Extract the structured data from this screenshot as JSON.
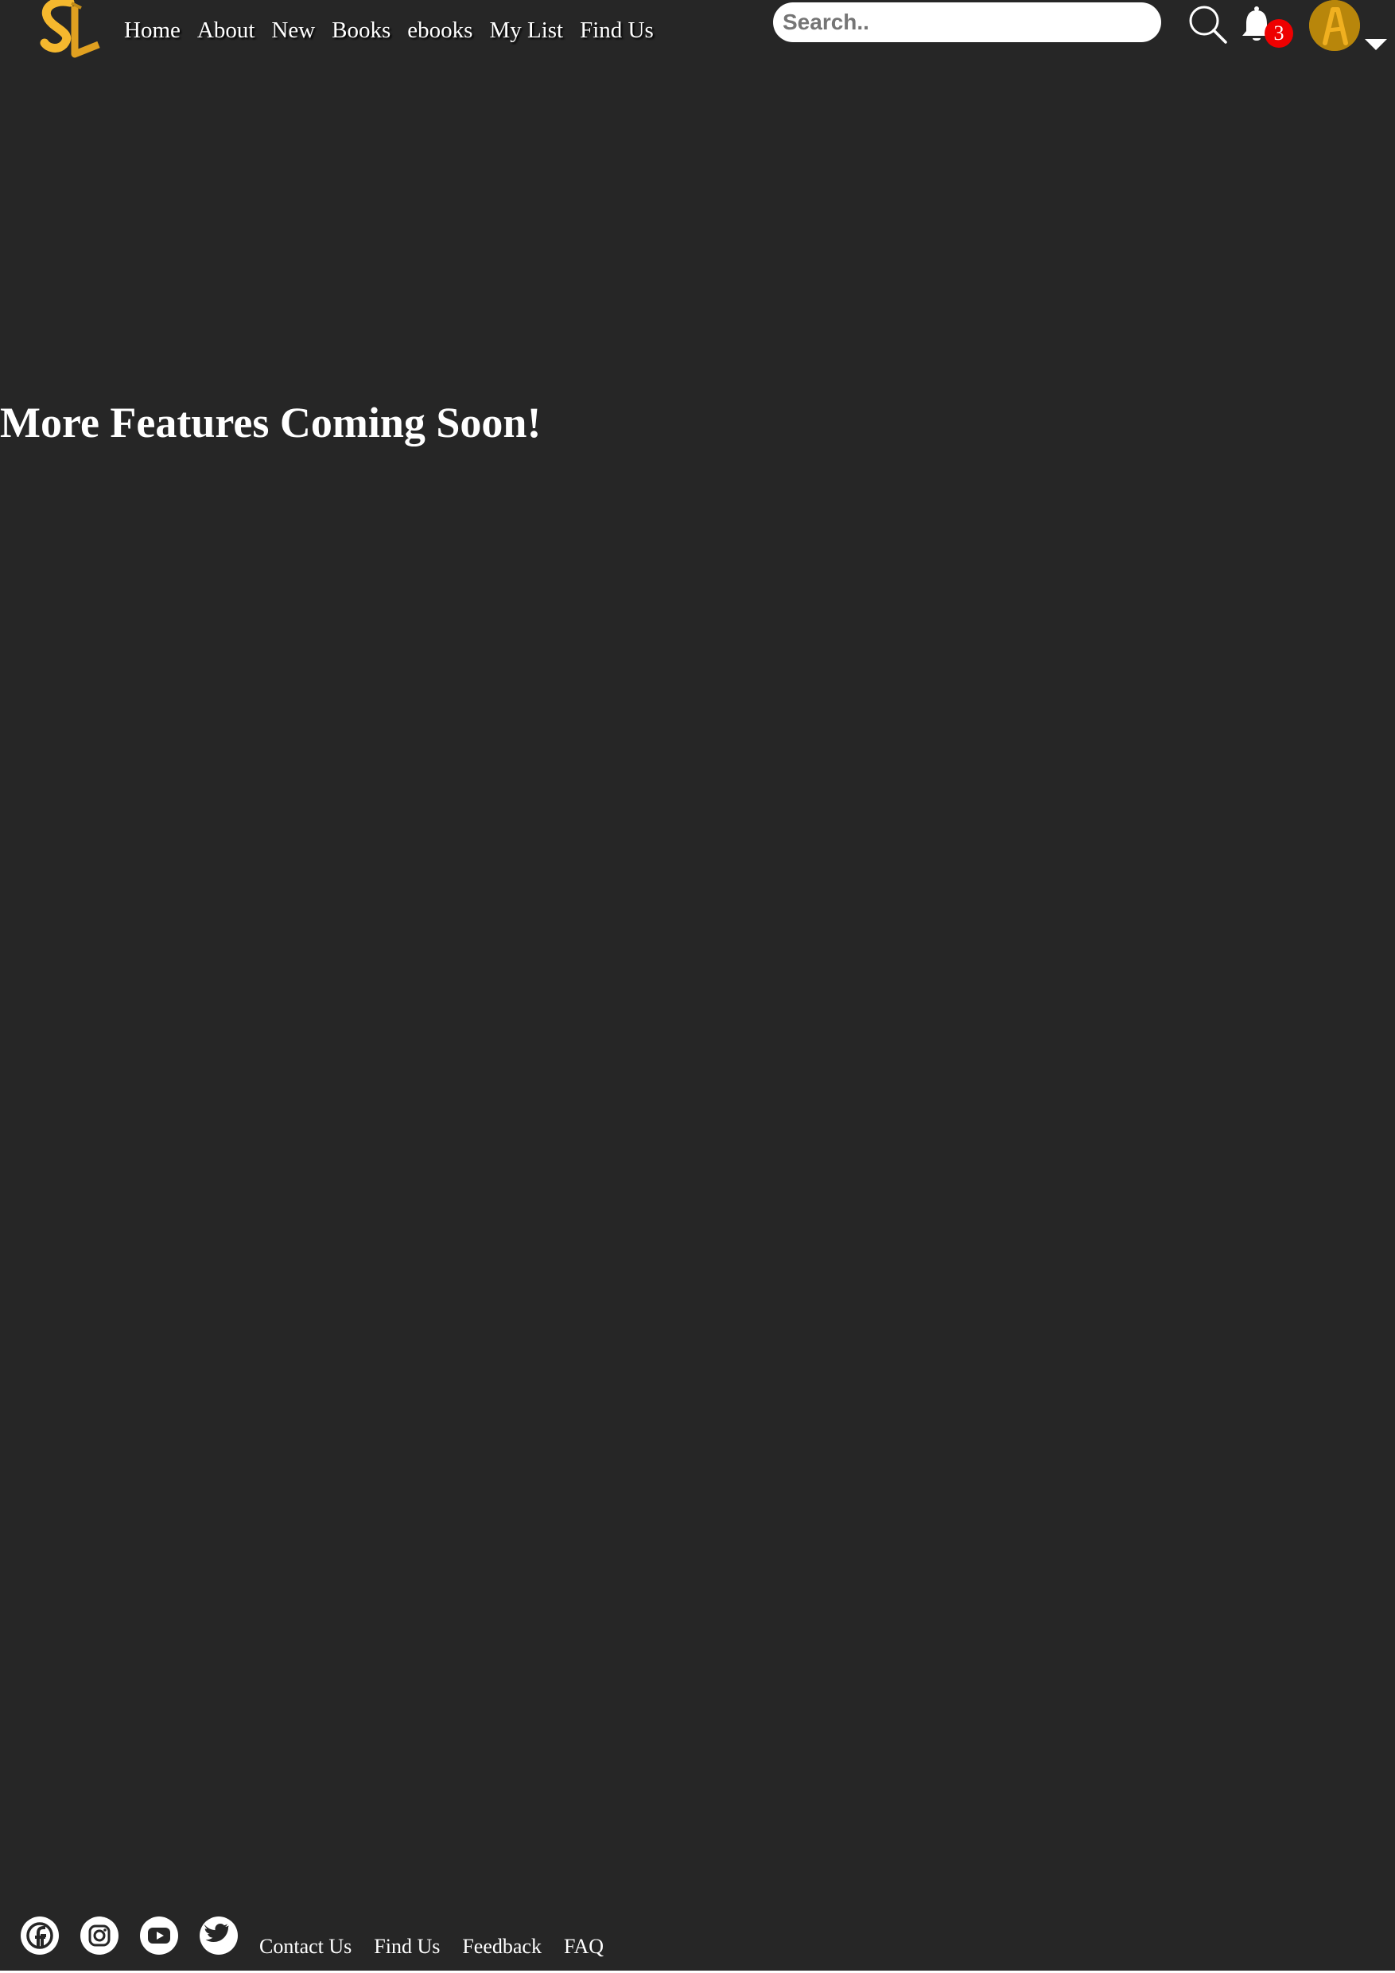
{
  "header": {
    "nav": [
      {
        "label": "Home"
      },
      {
        "label": "About"
      },
      {
        "label": "New"
      },
      {
        "label": "Books"
      },
      {
        "label": "ebooks"
      },
      {
        "label": "My List"
      },
      {
        "label": "Find Us"
      }
    ],
    "search": {
      "placeholder": "Search..",
      "value": ""
    },
    "notifications": {
      "count": "3",
      "icon": "bell-icon"
    },
    "avatar": {
      "icon": "avatar-letter-a"
    }
  },
  "main": {
    "headline": "More Features Coming Soon!"
  },
  "footer": {
    "social": [
      {
        "icon": "facebook-icon"
      },
      {
        "icon": "instagram-icon"
      },
      {
        "icon": "youtube-icon"
      },
      {
        "icon": "twitter-icon"
      }
    ],
    "links": [
      {
        "label": "Contact Us"
      },
      {
        "label": "Find Us"
      },
      {
        "label": "Feedback"
      },
      {
        "label": "FAQ"
      }
    ]
  },
  "colors": {
    "background": "#262626",
    "brand_gold": "#f5b82e",
    "avatar": "#b8860b",
    "badge": "#ee0000",
    "text": "#ffffff"
  }
}
